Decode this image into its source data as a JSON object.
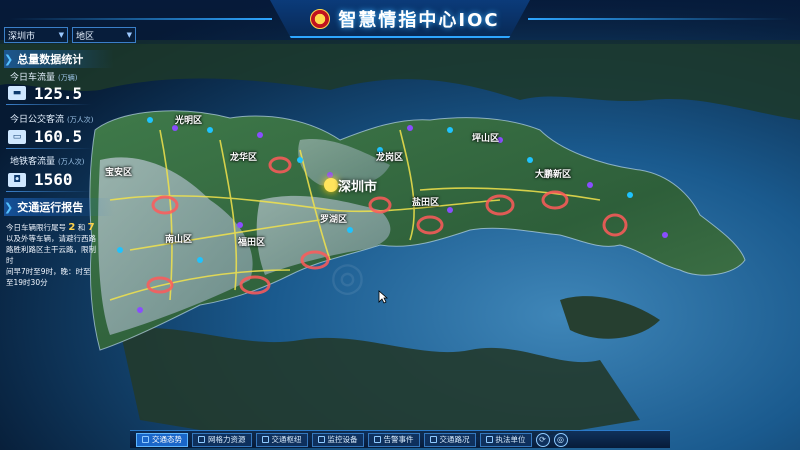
{
  "header": {
    "title": "智慧情指中心IOC",
    "region_select": "深圳市",
    "area_select": "地区"
  },
  "left_panel": {
    "stats_title": "总量数据统计",
    "stats": [
      {
        "label": "今日车流量",
        "unit": "(万辆)",
        "value": "125.5",
        "icon": "car-icon"
      },
      {
        "label": "今日公交客流",
        "unit": "(万人次)",
        "value": "160.5",
        "icon": "bus-icon"
      },
      {
        "label": "地铁客流量",
        "unit": "(万人次)",
        "value": "1560",
        "icon": "metro-icon"
      }
    ],
    "report_title": "交通运行报告",
    "report": {
      "line1_prefix": "今日车辆限行尾号",
      "num_a": "2",
      "mid": "和",
      "num_b": "7",
      "line2": "以及外等车辆，请避行西路",
      "line3": "路胜利路区主干云路，限制时",
      "line4": "间早7时至9时，晚：时至",
      "line5": "至19时30分"
    }
  },
  "map": {
    "city_label": "深圳市",
    "districts": [
      "光明区",
      "龙华区",
      "龙岗区",
      "坪山区",
      "宝安区",
      "大鹏新区",
      "罗湖区",
      "盐田区",
      "南山区",
      "福田区"
    ]
  },
  "toolbar": {
    "buttons": [
      {
        "label": "交通态势",
        "icon": "traffic-icon",
        "active": true
      },
      {
        "label": "网格力资源",
        "icon": "grid-icon",
        "active": false
      },
      {
        "label": "交通枢纽",
        "icon": "hub-icon",
        "active": false
      },
      {
        "label": "监控设备",
        "icon": "camera-icon",
        "active": false
      },
      {
        "label": "告警事件",
        "icon": "alarm-icon",
        "active": false
      },
      {
        "label": "交通路况",
        "icon": "road-icon",
        "active": false
      },
      {
        "label": "执法单位",
        "icon": "police-icon",
        "active": false
      }
    ]
  },
  "colors": {
    "accent": "#2ea6ff",
    "highlight": "#ffd24a",
    "hotspot": "#ff5a5a"
  }
}
